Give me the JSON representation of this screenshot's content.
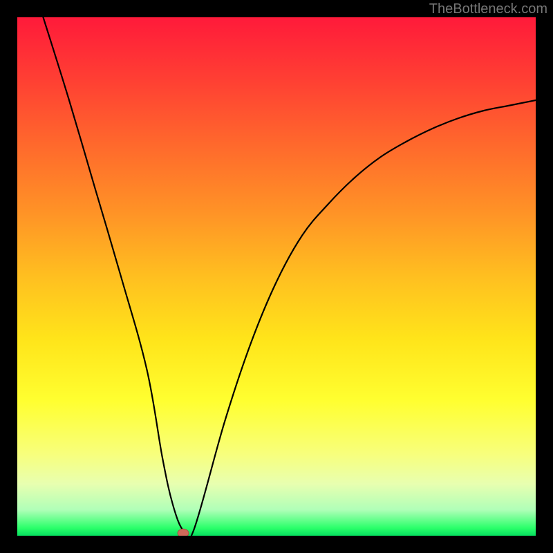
{
  "watermark": "TheBottleneck.com",
  "chart_data": {
    "type": "line",
    "title": "",
    "xlabel": "",
    "ylabel": "",
    "xlim": [
      0,
      100
    ],
    "ylim": [
      0,
      100
    ],
    "grid": false,
    "legend": false,
    "background_gradient": {
      "top_color": "#ff1a3a",
      "bottom_color": "#06e060",
      "meaning_top": "high bottleneck",
      "meaning_bottom": "no bottleneck"
    },
    "series": [
      {
        "name": "bottleneck_curve",
        "color": "#000000",
        "x": [
          5,
          10,
          15,
          20,
          25,
          28,
          30,
          32,
          34,
          40,
          45,
          50,
          55,
          60,
          65,
          70,
          75,
          80,
          85,
          90,
          95,
          100
        ],
        "y": [
          100,
          84,
          67,
          50,
          32,
          15,
          6,
          1,
          1,
          22,
          37,
          49,
          58,
          64,
          69,
          73,
          76,
          78.5,
          80.5,
          82,
          83,
          84
        ]
      }
    ],
    "minimum_point": {
      "x": 32,
      "y": 0.5,
      "color": "#cf6a5a"
    }
  }
}
